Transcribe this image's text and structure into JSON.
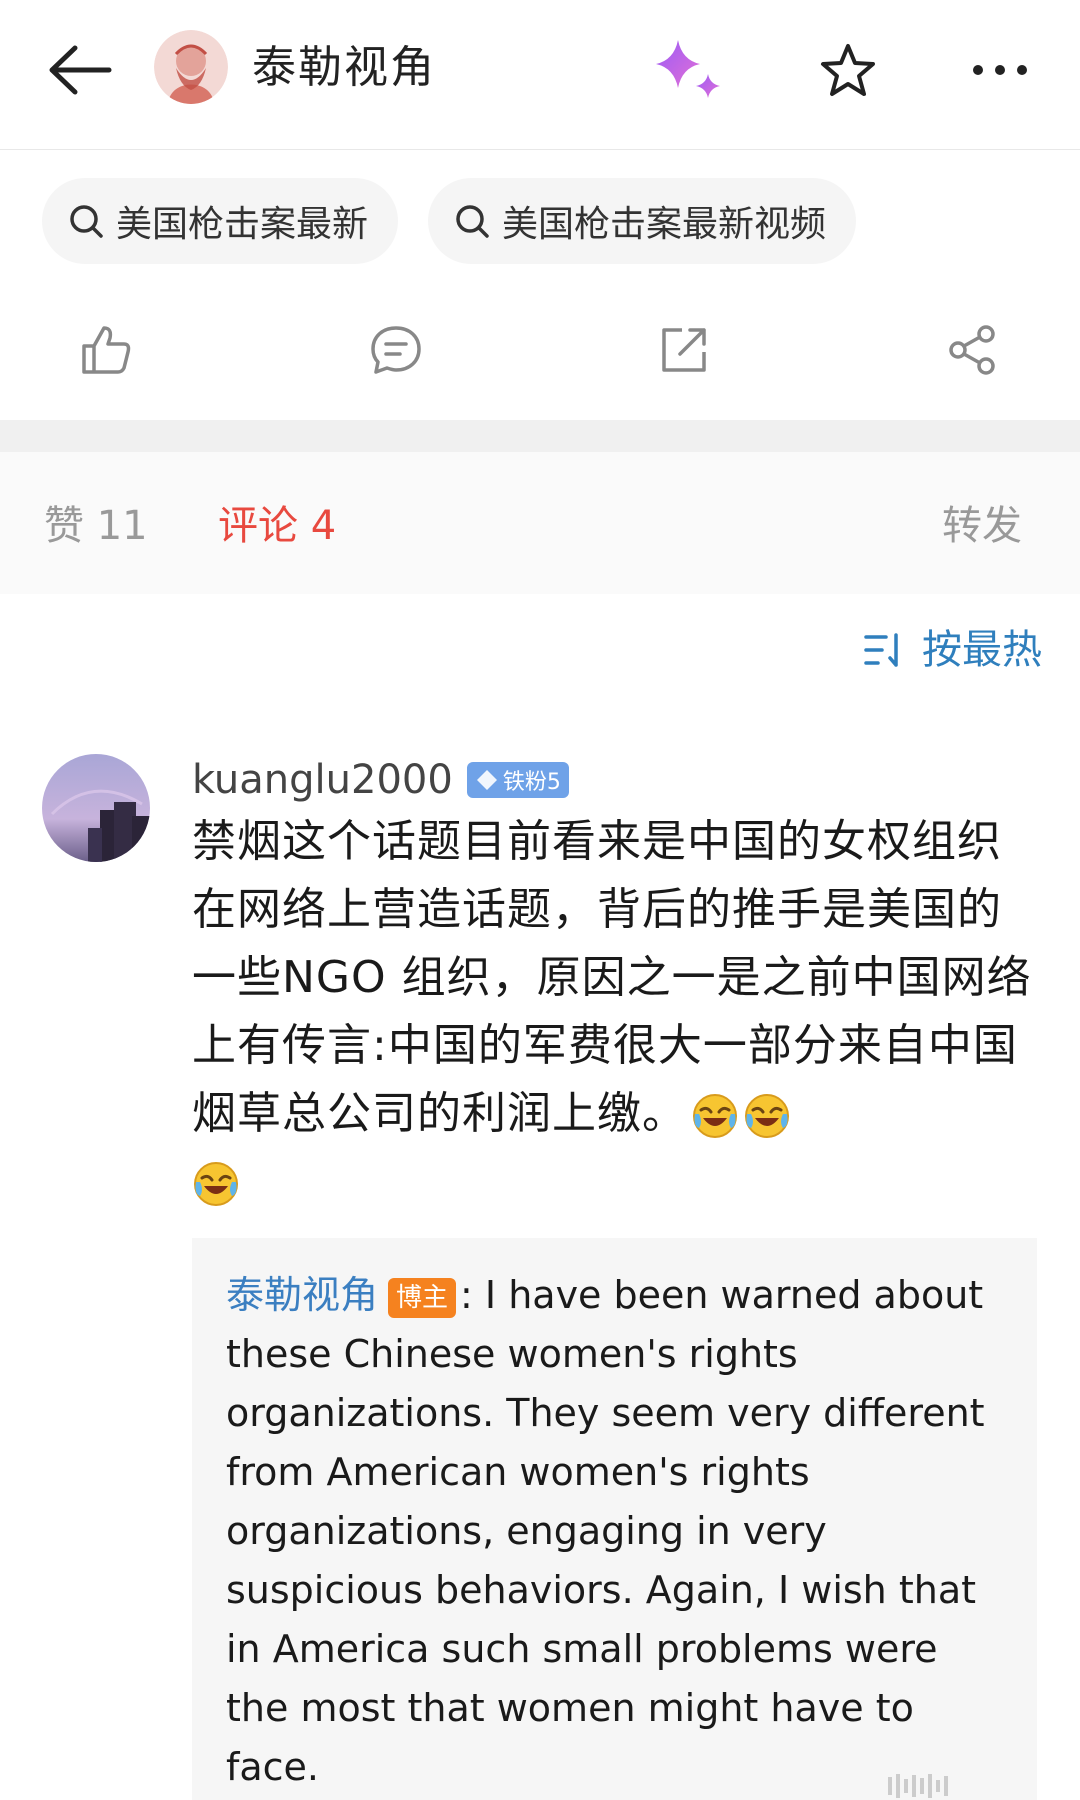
{
  "header": {
    "title": "泰勒视角",
    "back_icon": "arrow-left-icon",
    "sparkle_icon": "ai-sparkle-icon",
    "star_icon": "star-outline-icon",
    "more_icon": "more-dots-icon"
  },
  "search_chips": [
    {
      "label": "美国枪击案最新",
      "icon": "search-icon"
    },
    {
      "label": "美国枪击案最新视频",
      "icon": "search-icon"
    }
  ],
  "actions": {
    "like_icon": "thumbs-up-icon",
    "comment_icon": "comment-bubble-icon",
    "repost_icon": "repost-icon",
    "share_icon": "share-icon"
  },
  "tabs": {
    "likes": "赞 11",
    "comments": "评论 4",
    "repost": "转发"
  },
  "sort": {
    "label": "按最热",
    "icon": "sort-icon"
  },
  "comment": {
    "username": "kuanglu2000",
    "badge": "铁粉5",
    "text": "禁烟这个话题目前看来是中国的女权组织在网络上营造话题，背后的推手是美国的一些NGO 组织，原因之一是之前中国网络上有传言:中国的军费很大一部分来自中国烟草总公司的利润上缴。",
    "emoji_icon": "laughing-crying-emoji-icon",
    "reply": {
      "author": "泰勒视角",
      "author_tag": "博主",
      "text": ": I have been warned about these Chinese women's rights organizations. They seem very different from American women's rights organizations, engaging in very suspicious behaviors. Again, I wish that in America such small problems were the most that women might have to face."
    }
  },
  "colors": {
    "accent_red": "#e8493f",
    "link_blue": "#3b7fc1",
    "sort_blue": "#2f7fbd",
    "blogger_orange": "#f5821f",
    "badge_blue": "#6fa2e8"
  }
}
